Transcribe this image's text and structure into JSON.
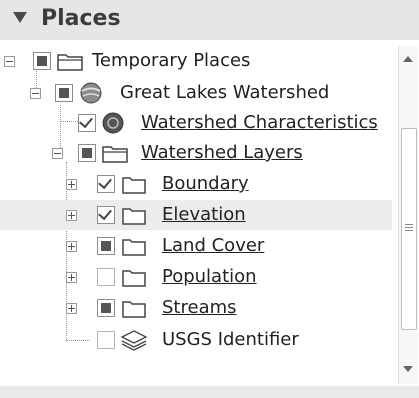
{
  "header": {
    "title": "Places",
    "collapse_icon": "triangle-down-icon"
  },
  "tree": {
    "root": {
      "label": "Temporary Places",
      "icon": "folder-icon",
      "state": "filled"
    },
    "watershed": {
      "label": "Great Lakes Watershed",
      "icon": "globe-icon",
      "state": "filled"
    },
    "characteristics": {
      "label": "Watershed Characteristics",
      "icon": "circle-layer-icon",
      "state": "checked"
    },
    "layers": {
      "label": "Watershed Layers",
      "icon": "folder-icon",
      "state": "filled"
    },
    "items": [
      {
        "label": "Boundary",
        "state": "checked",
        "icon": "folder-icon"
      },
      {
        "label": "Elevation",
        "state": "checked",
        "icon": "folder-icon"
      },
      {
        "label": "Land Cover",
        "state": "filled",
        "icon": "folder-icon"
      },
      {
        "label": "Population",
        "state": "empty",
        "icon": "folder-icon"
      },
      {
        "label": "Streams",
        "state": "filled",
        "icon": "folder-icon"
      }
    ],
    "identifier": {
      "label": "USGS Identifier",
      "icon": "layers-stack-icon",
      "state": "empty"
    }
  },
  "colors": {
    "header_bg": "#e6e6e6",
    "panel_bg": "#ffffff",
    "selected_row": "#ececec"
  }
}
